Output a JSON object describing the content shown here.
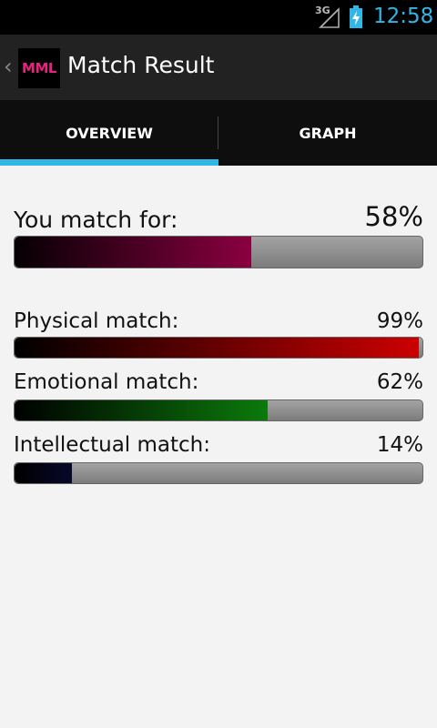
{
  "status": {
    "network": "3G",
    "time": "12:58",
    "accent": "#33b5e5"
  },
  "app": {
    "logo_text": "MML",
    "title": "Match Result"
  },
  "tabs": [
    {
      "label": "OVERVIEW",
      "active": true
    },
    {
      "label": "GRAPH",
      "active": false
    }
  ],
  "overall": {
    "label": "You match for:",
    "percent_text": "58%",
    "value": 58
  },
  "categories": [
    {
      "label": "Physical match:",
      "percent_text": "99%",
      "value": 99
    },
    {
      "label": "Emotional match:",
      "percent_text": "62%",
      "value": 62
    },
    {
      "label": "Intellectual match:",
      "percent_text": "14%",
      "value": 14
    }
  ]
}
